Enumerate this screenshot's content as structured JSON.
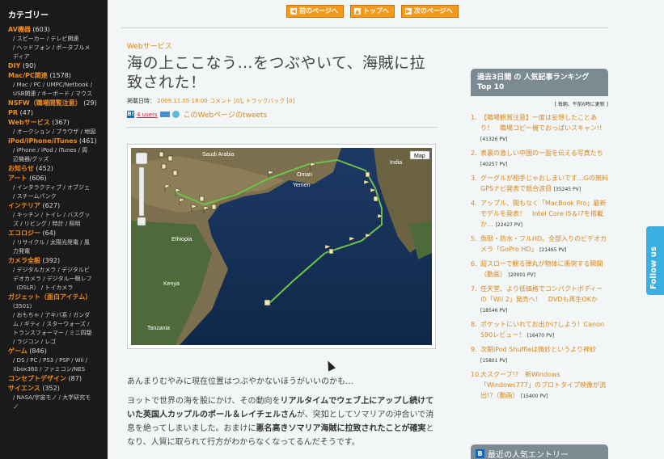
{
  "sidebar": {
    "heading": "カテゴリー",
    "categories": [
      {
        "name": "AV機器",
        "count": "(603)",
        "subs": [
          "/ スピーカー / テレビ関連",
          "/ ヘッドフォン / ポータブルメ",
          "ディア"
        ]
      },
      {
        "name": "DIY",
        "count": "(90)",
        "subs": []
      },
      {
        "name": "Mac/PC関連",
        "count": "(1578)",
        "subs": [
          "/ Mac / PC / UMPC/Netbook /",
          "USB関連 / キーボード / マウス"
        ]
      },
      {
        "name": "NSFW（職場閲覧注意）",
        "count": "(29)",
        "subs": []
      },
      {
        "name": "PR",
        "count": "(47)",
        "subs": []
      },
      {
        "name": "Webサービス",
        "count": "(367)",
        "subs": [
          "/ オークション / ブラウザ / 地図"
        ]
      },
      {
        "name": "iPod/iPhone/iTunes",
        "count": "(461)",
        "subs": [
          "/ iPhone / iPod / iTunes / 周",
          "辺機器/グッズ"
        ]
      },
      {
        "name": "お知らせ",
        "count": "(452)",
        "subs": []
      },
      {
        "name": "アート",
        "count": "(606)",
        "subs": [
          "/ インタラクティブ / オブジェ",
          "/ スチームパンク"
        ]
      },
      {
        "name": "インテリア",
        "count": "(627)",
        "subs": [
          "/ キッチン / トイレ / バスグッ",
          "ズ / リビング / 時計 / 照明"
        ]
      },
      {
        "name": "エコロジー",
        "count": "(64)",
        "subs": [
          "/ リサイクル / 太陽光発電 / 風",
          "力発電"
        ]
      },
      {
        "name": "カメラ全般",
        "count": "(392)",
        "subs": [
          "/ デジタルカメラ / デジタルビ",
          "デオカメラ / デジタル一眼レフ",
          "（DSLR） / トイカメラ"
        ]
      },
      {
        "name": "ガジェット（面白アイテム）",
        "count": "",
        "subs": [
          "(3501)",
          "/ おもちゃ / アキバ系 / ガンダ",
          "ム / ギティ / スターウォーズ /",
          "トランスフォーマー / ミニ四駆",
          "/ ラジコン / レゴ"
        ]
      },
      {
        "name": "ゲーム",
        "count": "(846)",
        "subs": [
          "/ DS / PC / PS3 / PSP / Wii /",
          "Xbox360 / ファミコン/NES"
        ]
      },
      {
        "name": "コンセプトデザイン",
        "count": "(87)",
        "subs": []
      },
      {
        "name": "サイエンス",
        "count": "(352)",
        "subs": [
          "/ NASA/宇宙モノ / 大学研究モ",
          "ノ"
        ]
      }
    ]
  },
  "topnav": {
    "prev": "前のページへ",
    "top": "トップへ",
    "next": "次のページへ"
  },
  "article": {
    "category": "Webサービス",
    "title": "海の上ここなう…をつぶやいて、海賊に拉致された！",
    "meta_prefix": "掲載日時：",
    "date": "2009.11.05 18:00",
    "comments": "コメント [0]",
    "trackbacks": "トラックバック [0]",
    "users": "4 users",
    "tweets": "このWebページのtweets",
    "map_label": "Map",
    "map_places": {
      "saudi": "Saudi Arabia",
      "yemen": "Yemen",
      "oman": "Oman",
      "india": "India",
      "ethiopia": "Ethiopia",
      "kenya": "Kenya",
      "tanzania": "Tanzania"
    },
    "intro": "あんまりむやみに現在位置はつぶやかないほうがいいのかも…",
    "para1_a": "ヨットで世界の海を股にかけ、その動向を",
    "para1_b": "リアルタイムでウェブ上にアップし続けていた英国人カップルのポール＆レイチェルさん",
    "para1_c": "が、突如としてソマリアの沖合いで消息を絶ってしまいました。おまけに",
    "para1_d": "悪名高きソマリア海賊に拉致されたことが確実",
    "para1_e": "となり、人質に取られて行方がわからなくなってるんだそうです。"
  },
  "ranking": {
    "heading": "過去3日間 の 人気記事ランキング Top 10",
    "note": "[ 毎朝、午前6時に更新 ]",
    "items": [
      {
        "num": "1.",
        "title": "【職場観賞注意】一度は妄想したことあり！　職場コピー機でおっぱいスキャン!!",
        "pv": "[41326 PV]"
      },
      {
        "num": "2.",
        "title": "表裏の激しい中国の一面を伝える写真たち",
        "pv": "[40257 PV]"
      },
      {
        "num": "3.",
        "title": "グーグルが相手じゃおしまいです…Gの無料GPSナビ発表で競合涙目",
        "pv": "[35245 PV]"
      },
      {
        "num": "4.",
        "title": "アップル、間もなく「MacBook Pro」最新モデルを発表！　Intel Core i5＆i7を搭載か…",
        "pv": "[22427 PV]"
      },
      {
        "num": "5.",
        "title": "魚眼・防水・フルHD。全部入りのビデオカメラ「GoPro HD」",
        "pv": "[21465 PV]"
      },
      {
        "num": "6.",
        "title": "超スローで観る弾丸が物体に衝突する瞬間（動画）",
        "pv": "[20001 PV]"
      },
      {
        "num": "7.",
        "title": "任天堂、より低価格でコンパクトボディーの「Wii 2」発売へ！　DVDも再生OKか",
        "pv": "[18546 PV]"
      },
      {
        "num": "8.",
        "title": "ポケットにいれてお出かけしよう！Canon S90レビュー！",
        "pv": "[16470 PV]"
      },
      {
        "num": "9.",
        "title": "次期iPod Shuffleは微妙というより神妙",
        "pv": "[15801 PV]"
      },
      {
        "num": "10.",
        "title": "大スクープ!?　新Windows「Windows777」のプロトタイプ映像が流出!?（動画）",
        "pv": "[15400 PV]"
      }
    ]
  },
  "recent": {
    "heading": "最近の人気エントリー"
  },
  "followus": "Follow us",
  "colors": {
    "accent": "#f39a1c",
    "link": "#d8881c",
    "sidebar_bg": "#1a1a1a",
    "panel_header": "#7c8b92"
  }
}
